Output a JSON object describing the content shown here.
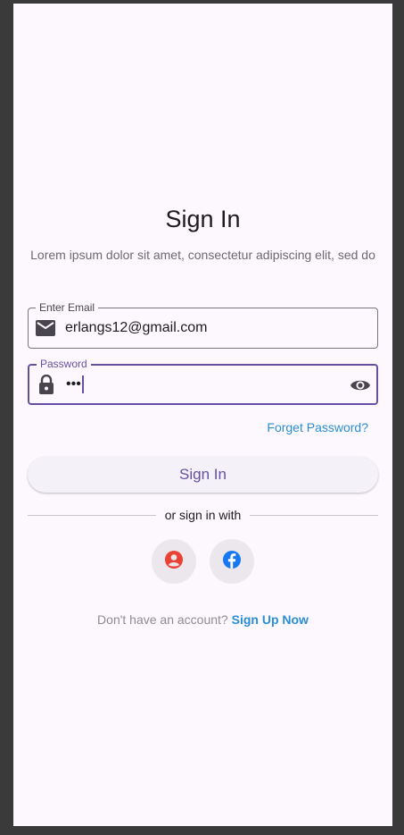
{
  "title": "Sign In",
  "subtitle": "Lorem ipsum dolor sit amet, consectetur adipiscing elit, sed do",
  "email": {
    "label": "Enter Email",
    "value": "erlangs12@gmail.com",
    "icon": "mail-icon"
  },
  "password": {
    "label": "Password",
    "value": "•••",
    "icon": "lock-icon",
    "toggle_icon": "eye-icon"
  },
  "forgot_password": "Forget Password?",
  "signin_button": "Sign In",
  "divider_text": "or sign in with",
  "social": [
    {
      "icon": "google-account-icon",
      "color": "#ea4335"
    },
    {
      "icon": "facebook-icon",
      "color": "#1877f2"
    }
  ],
  "signup": {
    "prompt": "Don't have an account?",
    "link": "Sign Up Now"
  },
  "colors": {
    "accent": "#6750a4",
    "link": "#2a8fd4",
    "background": "#fdf7fe"
  }
}
